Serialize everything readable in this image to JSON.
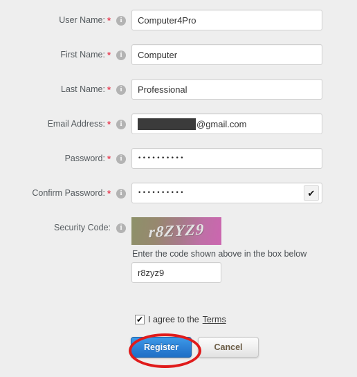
{
  "form": {
    "fields": [
      {
        "id": "user-name",
        "label": "User Name:",
        "required": "*",
        "info_icon": "info-icon",
        "value": "Computer4Pro"
      },
      {
        "id": "first-name",
        "label": "First Name:",
        "required": "*",
        "info_icon": "info-icon",
        "value": "Computer"
      },
      {
        "id": "last-name",
        "label": "Last Name:",
        "required": "*",
        "info_icon": "info-icon",
        "value": "Professional"
      },
      {
        "id": "email-address",
        "label": "Email Address:",
        "required": "*",
        "info_icon": "info-icon",
        "value": "@gmail.com",
        "redacted": true
      },
      {
        "id": "password",
        "label": "Password:",
        "required": "*",
        "info_icon": "info-icon",
        "value": "••••••••••"
      },
      {
        "id": "confirm-password",
        "label": "Confirm Password:",
        "required": "*",
        "info_icon": "info-icon",
        "value": "••••••••••",
        "valid_check": "✔"
      }
    ],
    "security": {
      "label": "Security Code:",
      "info_icon": "info-icon",
      "captcha_text": "r8ZYZ9",
      "hint": "Enter the code shown above in the box below",
      "input_value": "r8zyz9"
    },
    "agreement": {
      "checkbox_mark": "✔",
      "text": "I agree to the",
      "link": "Terms",
      "checked": true
    },
    "buttons": {
      "register": "Register",
      "cancel": "Cancel"
    },
    "annotation": {
      "shape": "red-ellipse",
      "target": "Register",
      "color": "#e01b1b"
    },
    "colors": {
      "background": "#eeeeee",
      "required_asterisk": "#e8455a",
      "label_text": "#555b5f",
      "register_button": "#2f84d8",
      "redaction": "#3b3b3b",
      "annotation": "#e01b1b"
    }
  }
}
